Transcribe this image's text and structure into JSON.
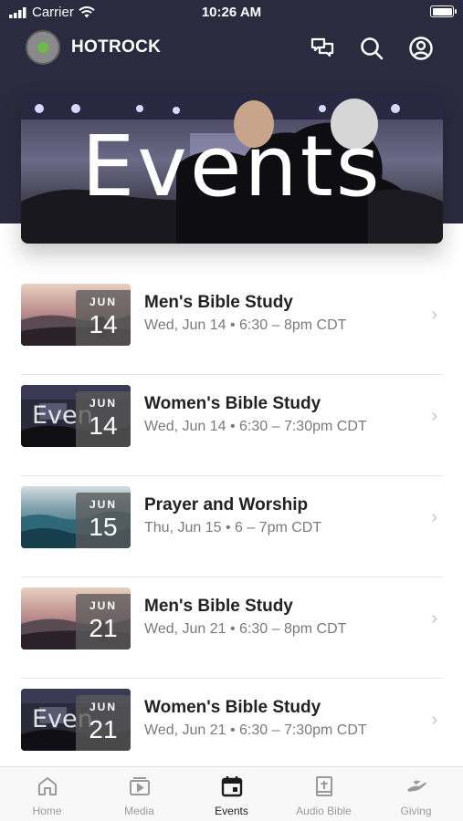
{
  "status_bar": {
    "carrier": "Carrier",
    "time": "10:26 AM"
  },
  "app_bar": {
    "title": "HOTROCK"
  },
  "hero": {
    "title": "Events"
  },
  "events": [
    {
      "title": "Men's Bible Study",
      "meta": "Wed, Jun 14 • 6:30 – 8pm CDT",
      "month": "JUN",
      "day": "14",
      "thumb": "sunset"
    },
    {
      "title": "Women's Bible Study",
      "meta": "Wed, Jun 14 • 6:30 – 7:30pm CDT",
      "month": "JUN",
      "day": "14",
      "thumb": "events",
      "thumb_word": "Even"
    },
    {
      "title": "Prayer and Worship",
      "meta": "Thu, Jun 15 • 6 – 7pm CDT",
      "month": "JUN",
      "day": "15",
      "thumb": "ocean"
    },
    {
      "title": "Men's Bible Study",
      "meta": "Wed, Jun 21 • 6:30 – 8pm CDT",
      "month": "JUN",
      "day": "21",
      "thumb": "sunset"
    },
    {
      "title": "Women's Bible Study",
      "meta": "Wed, Jun 21 • 6:30 – 7:30pm CDT",
      "month": "JUN",
      "day": "21",
      "thumb": "events",
      "thumb_word": "Even"
    }
  ],
  "tabs": [
    {
      "label": "Home",
      "icon": "home-icon"
    },
    {
      "label": "Media",
      "icon": "media-icon"
    },
    {
      "label": "Events",
      "icon": "calendar-icon",
      "active": true
    },
    {
      "label": "Audio Bible",
      "icon": "bible-icon"
    },
    {
      "label": "Giving",
      "icon": "giving-icon"
    }
  ],
  "colors": {
    "header_bg": "#2c2a3e",
    "active_tab": "#1c1c1c",
    "inactive_tab": "#9a9a9a"
  }
}
